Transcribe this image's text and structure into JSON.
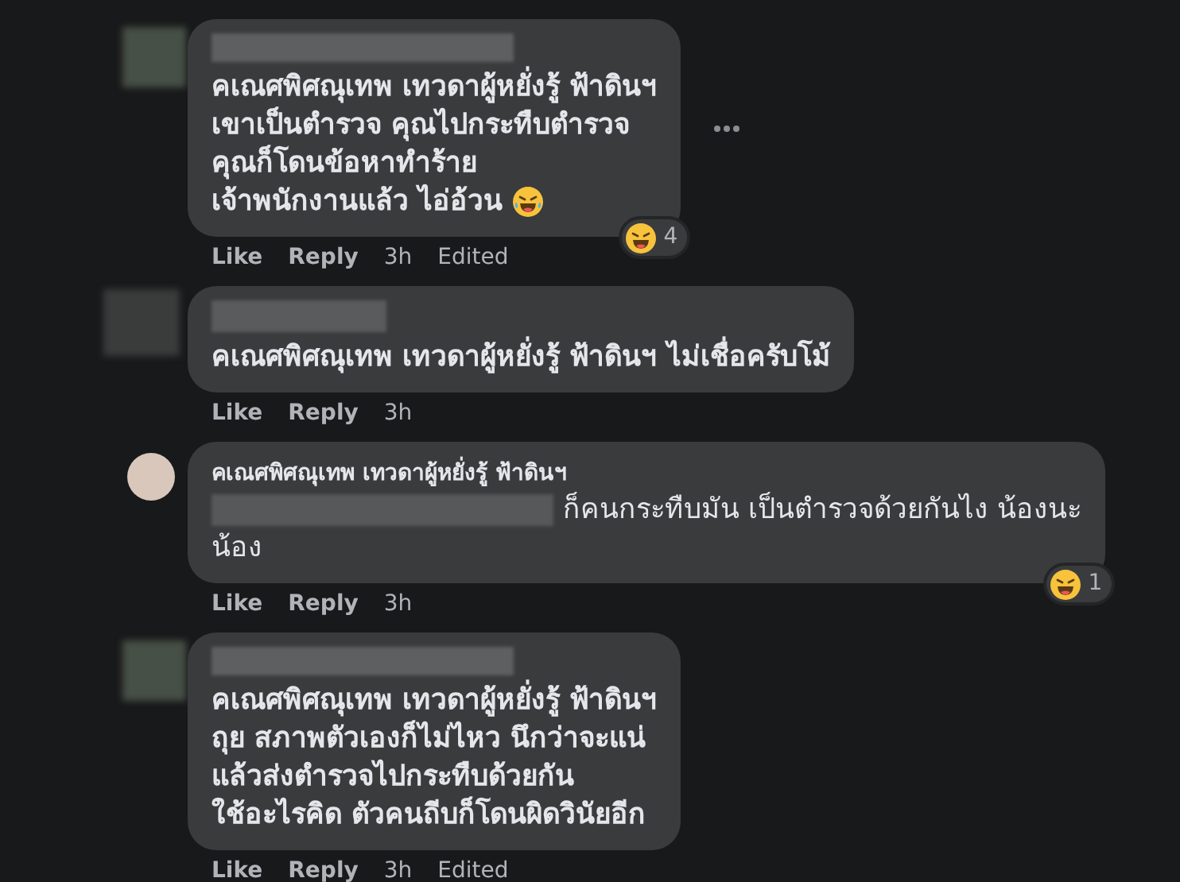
{
  "comments": [
    {
      "kind": "hidden_author",
      "show_more": true,
      "hidden_mention": false,
      "lines": [
        "คเณศพิศณุเทพ เทวดาผู้หยั่งรู้ ฟ้าดินฯ",
        "เขาเป็นตำรวจ คุณไปกระทืบตำรวจ",
        "คุณก็โดนข้อหาทำร้าย",
        "เจ้าพนักงานแล้ว ไอ่อ้วน"
      ],
      "trailing_emoji": true,
      "reaction_count": "4",
      "actions": [
        "Like",
        "Reply"
      ],
      "time": "3h",
      "edited": "Edited"
    },
    {
      "kind": "hidden_author_wide",
      "show_more": false,
      "hidden_mention": false,
      "lines": [
        "คเณศพิศณุเทพ เทวดาผู้หยั่งรู้ ฟ้าดินฯ ไม่เชื่อครับโม้"
      ],
      "trailing_emoji": false,
      "actions": [
        "Like",
        "Reply"
      ],
      "time": "3h"
    },
    {
      "kind": "named",
      "author": "คเณศพิศณุเทพ เทวดาผู้หยั่งรู้ ฟ้าดินฯ",
      "show_more": false,
      "hidden_mention": true,
      "lines": [
        "ก็คนกระทืบมัน เป็นตำรวจด้วยกันไง น้องนะ",
        "น้อง"
      ],
      "trailing_emoji": false,
      "reaction_count": "1",
      "actions": [
        "Like",
        "Reply"
      ],
      "time": "3h"
    },
    {
      "kind": "hidden_author",
      "show_more": false,
      "hidden_mention": false,
      "lines": [
        "คเณศพิศณุเทพ เทวดาผู้หยั่งรู้ ฟ้าดินฯ",
        "ถุย สภาพตัวเองก็ไม่ไหว นึกว่าจะแน่",
        "แล้วส่งตำรวจไปกระทืบด้วยกัน",
        "ใช้อะไรคิด ตัวคนถีบก็โดนผิดวินัยอีก"
      ],
      "trailing_emoji": false,
      "actions": [
        "Like",
        "Reply"
      ],
      "time": "3h",
      "edited": "Edited"
    }
  ]
}
